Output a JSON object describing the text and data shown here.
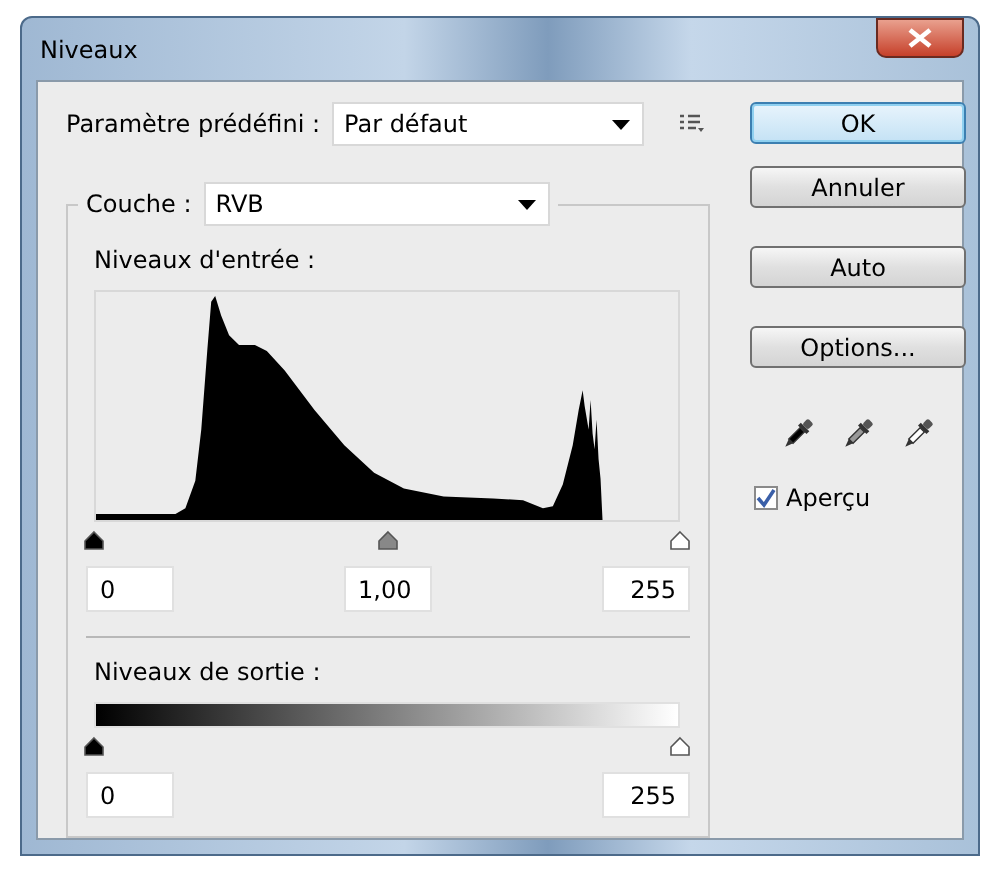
{
  "window": {
    "title": "Niveaux"
  },
  "preset": {
    "label": "Paramètre prédéfini :",
    "value": "Par défaut"
  },
  "channel": {
    "label": "Couche :",
    "value": "RVB"
  },
  "input_levels": {
    "label": "Niveaux d'entrée :",
    "black": {
      "level": 0,
      "value": "0"
    },
    "gamma": {
      "level": 0.5,
      "value": "1,00"
    },
    "white": {
      "level": 1,
      "value": "255"
    }
  },
  "output_levels": {
    "label": "Niveaux de sortie :",
    "black": {
      "level": 0,
      "value": "0"
    },
    "white": {
      "level": 1,
      "value": "255"
    }
  },
  "buttons": [
    {
      "label": "OK",
      "default": true
    },
    {
      "label": "Annuler",
      "default": false
    },
    {
      "label": "Auto",
      "default": false
    },
    {
      "label": "Options...",
      "default": false
    }
  ],
  "preview": {
    "label": "Aperçu",
    "checked": true
  }
}
